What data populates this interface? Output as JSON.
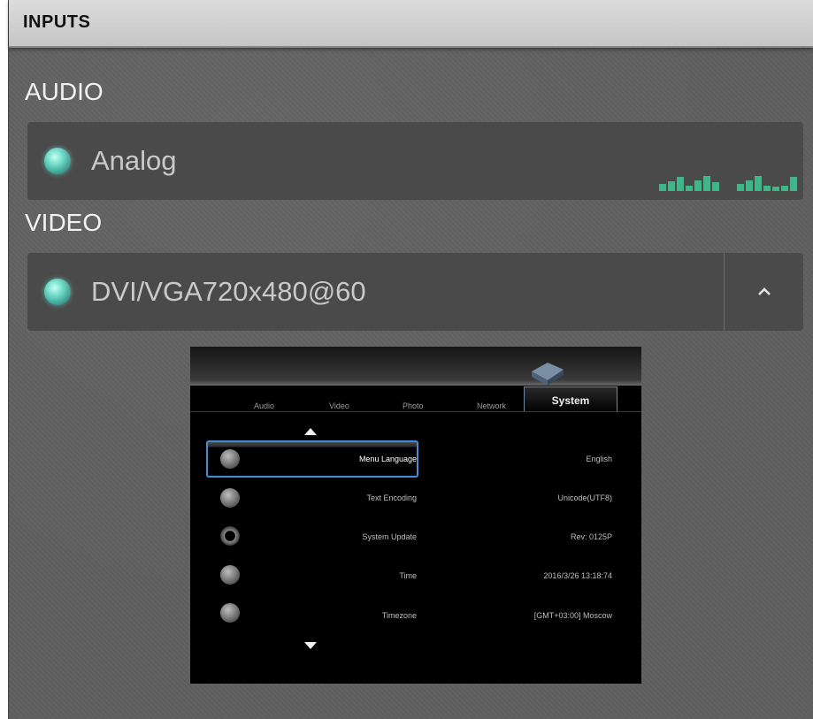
{
  "header": {
    "title": "INPUTS"
  },
  "audio": {
    "section_title": "AUDIO",
    "source": "Analog",
    "led_color": "#6fd9c6",
    "meter_color": "#3fb58a",
    "meters": [
      {
        "name": "left",
        "levels": [
          0.4,
          0.55,
          0.8,
          0.3,
          0.6,
          0.85,
          0.5
        ]
      },
      {
        "name": "right",
        "levels": [
          0.4,
          0.6,
          0.85,
          0.3,
          0.25,
          0.3,
          0.8
        ]
      }
    ]
  },
  "video": {
    "section_title": "VIDEO",
    "source": "DVI/VGA720x480@60",
    "collapse_icon": "chevron-up-icon",
    "preview": {
      "tabs": [
        "Audio",
        "Video",
        "Photo",
        "Network"
      ],
      "active_tab": "System",
      "items": [
        {
          "icon": "language-icon",
          "label": "Menu Language",
          "value": "English"
        },
        {
          "icon": "text-encoding-icon",
          "label": "Text Encoding",
          "value": "Unicode(UTF8)"
        },
        {
          "icon": "refresh-icon",
          "label": "System Update",
          "value": "Rev: 0125P"
        },
        {
          "icon": "clock-icon",
          "label": "Time",
          "value": "2016/3/26 13:18:74"
        },
        {
          "icon": "globe-icon",
          "label": "Timezone",
          "value": "[GMT+03:00] Moscow"
        }
      ]
    }
  }
}
